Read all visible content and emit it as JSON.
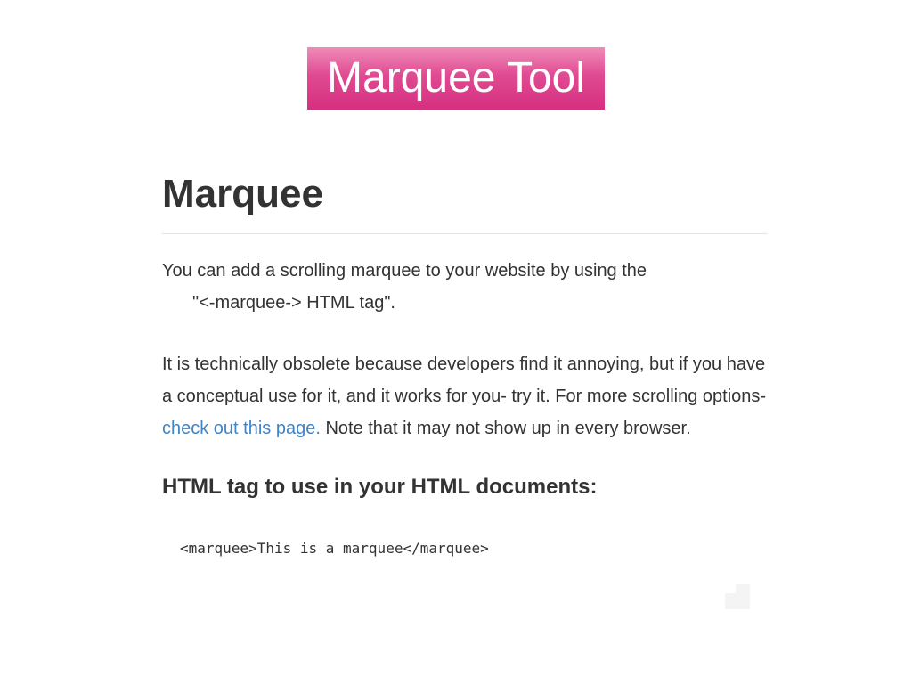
{
  "banner": {
    "title": "Marquee Tool",
    "gradient_top": "#ef8cb8",
    "gradient_bottom": "#d62f80",
    "text_color": "#ffffff"
  },
  "article": {
    "heading": "Marquee",
    "intro_line1": "You can add a scrolling marquee to your website by using the",
    "intro_line2": "\"<-marquee-> HTML tag\".",
    "body_part1": "It is technically obsolete because developers find it annoying, but if you have a conceptual use for it, and it works for you- try it. For more scrolling options- ",
    "body_link": "check out this page.",
    "body_part2": " Note that it may not show up in every browser.",
    "subheading": "HTML tag to use in your HTML documents:",
    "code_sample": "<marquee>This is a marquee</marquee>",
    "link_color": "#4183c4",
    "text_color": "#333333"
  }
}
